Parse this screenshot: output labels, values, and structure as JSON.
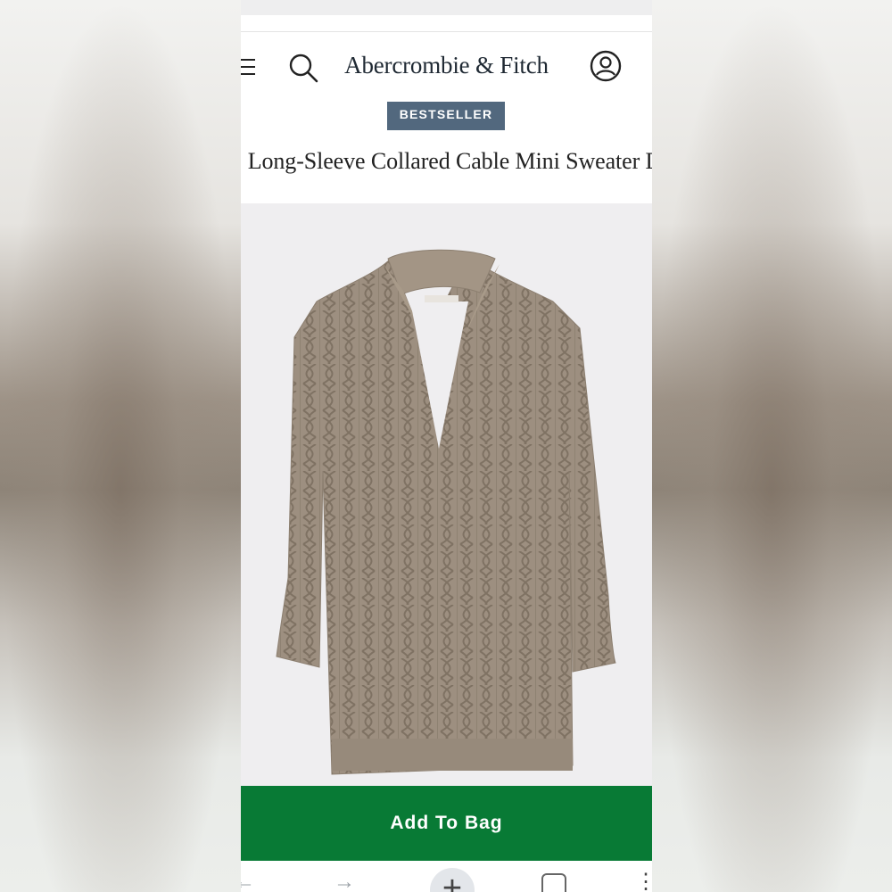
{
  "header": {
    "brand": "Abercrombie & Fitch"
  },
  "product": {
    "badge": "BESTSELLER",
    "title": "Long-Sleeve Collared Cable Mini Sweater Dress"
  },
  "actions": {
    "add_to_bag_label": "Add To Bag"
  },
  "colors": {
    "badge_bg": "#52687e",
    "cta_bg": "#087a35",
    "sweater": "#9a8c7c"
  },
  "icons": [
    "menu-icon",
    "search-icon",
    "account-icon",
    "back-icon",
    "forward-icon",
    "new-tab-icon",
    "tabs-icon",
    "more-icon"
  ]
}
